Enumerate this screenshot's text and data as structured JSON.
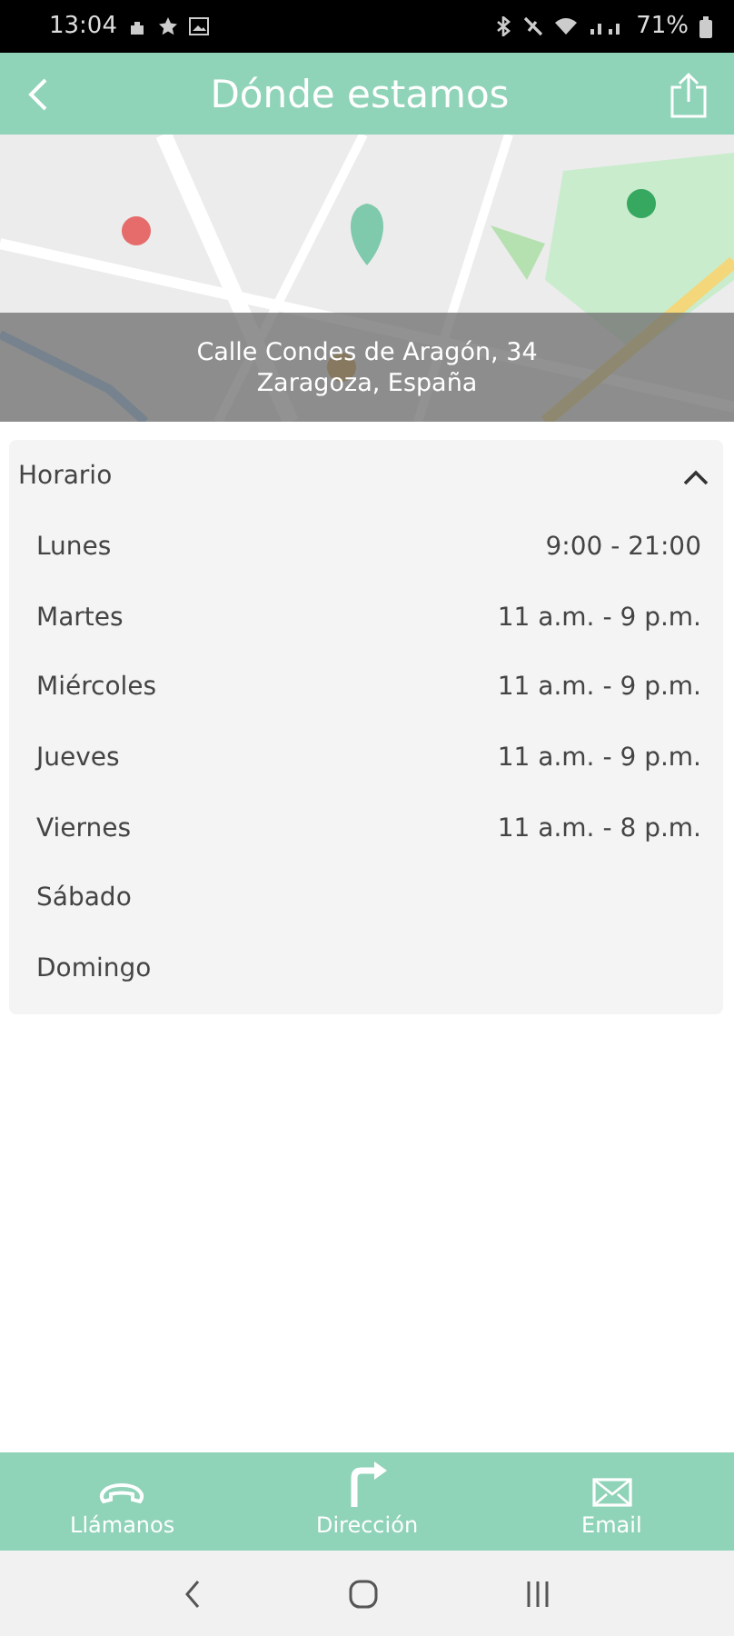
{
  "status_bar": {
    "time": "13:04",
    "battery": "71%"
  },
  "header": {
    "title": "Dónde estamos"
  },
  "map": {
    "kind": "picture",
    "address_lines": [
      "Calle Condes de Aragón, 34",
      "Zaragoza, España"
    ]
  },
  "hours": {
    "title": "Horario",
    "expanded": true,
    "days": [
      {
        "day": "Lunes",
        "time": "9:00 - 21:00"
      },
      {
        "day": "Martes",
        "time": "11 a.m. - 9 p.m."
      },
      {
        "day": "Miércoles",
        "time": "11 a.m. - 9 p.m."
      },
      {
        "day": "Jueves",
        "time": "11 a.m. - 9 p.m."
      },
      {
        "day": "Viernes",
        "time": "11 a.m. - 8 p.m."
      },
      {
        "day": "Sábado"
      },
      {
        "day": "Domingo"
      }
    ]
  },
  "actions": [
    {
      "kind": "phone",
      "label": "Llámanos"
    },
    {
      "kind": "direction",
      "label": "Dirección"
    },
    {
      "kind": "email",
      "label": "Email"
    }
  ]
}
